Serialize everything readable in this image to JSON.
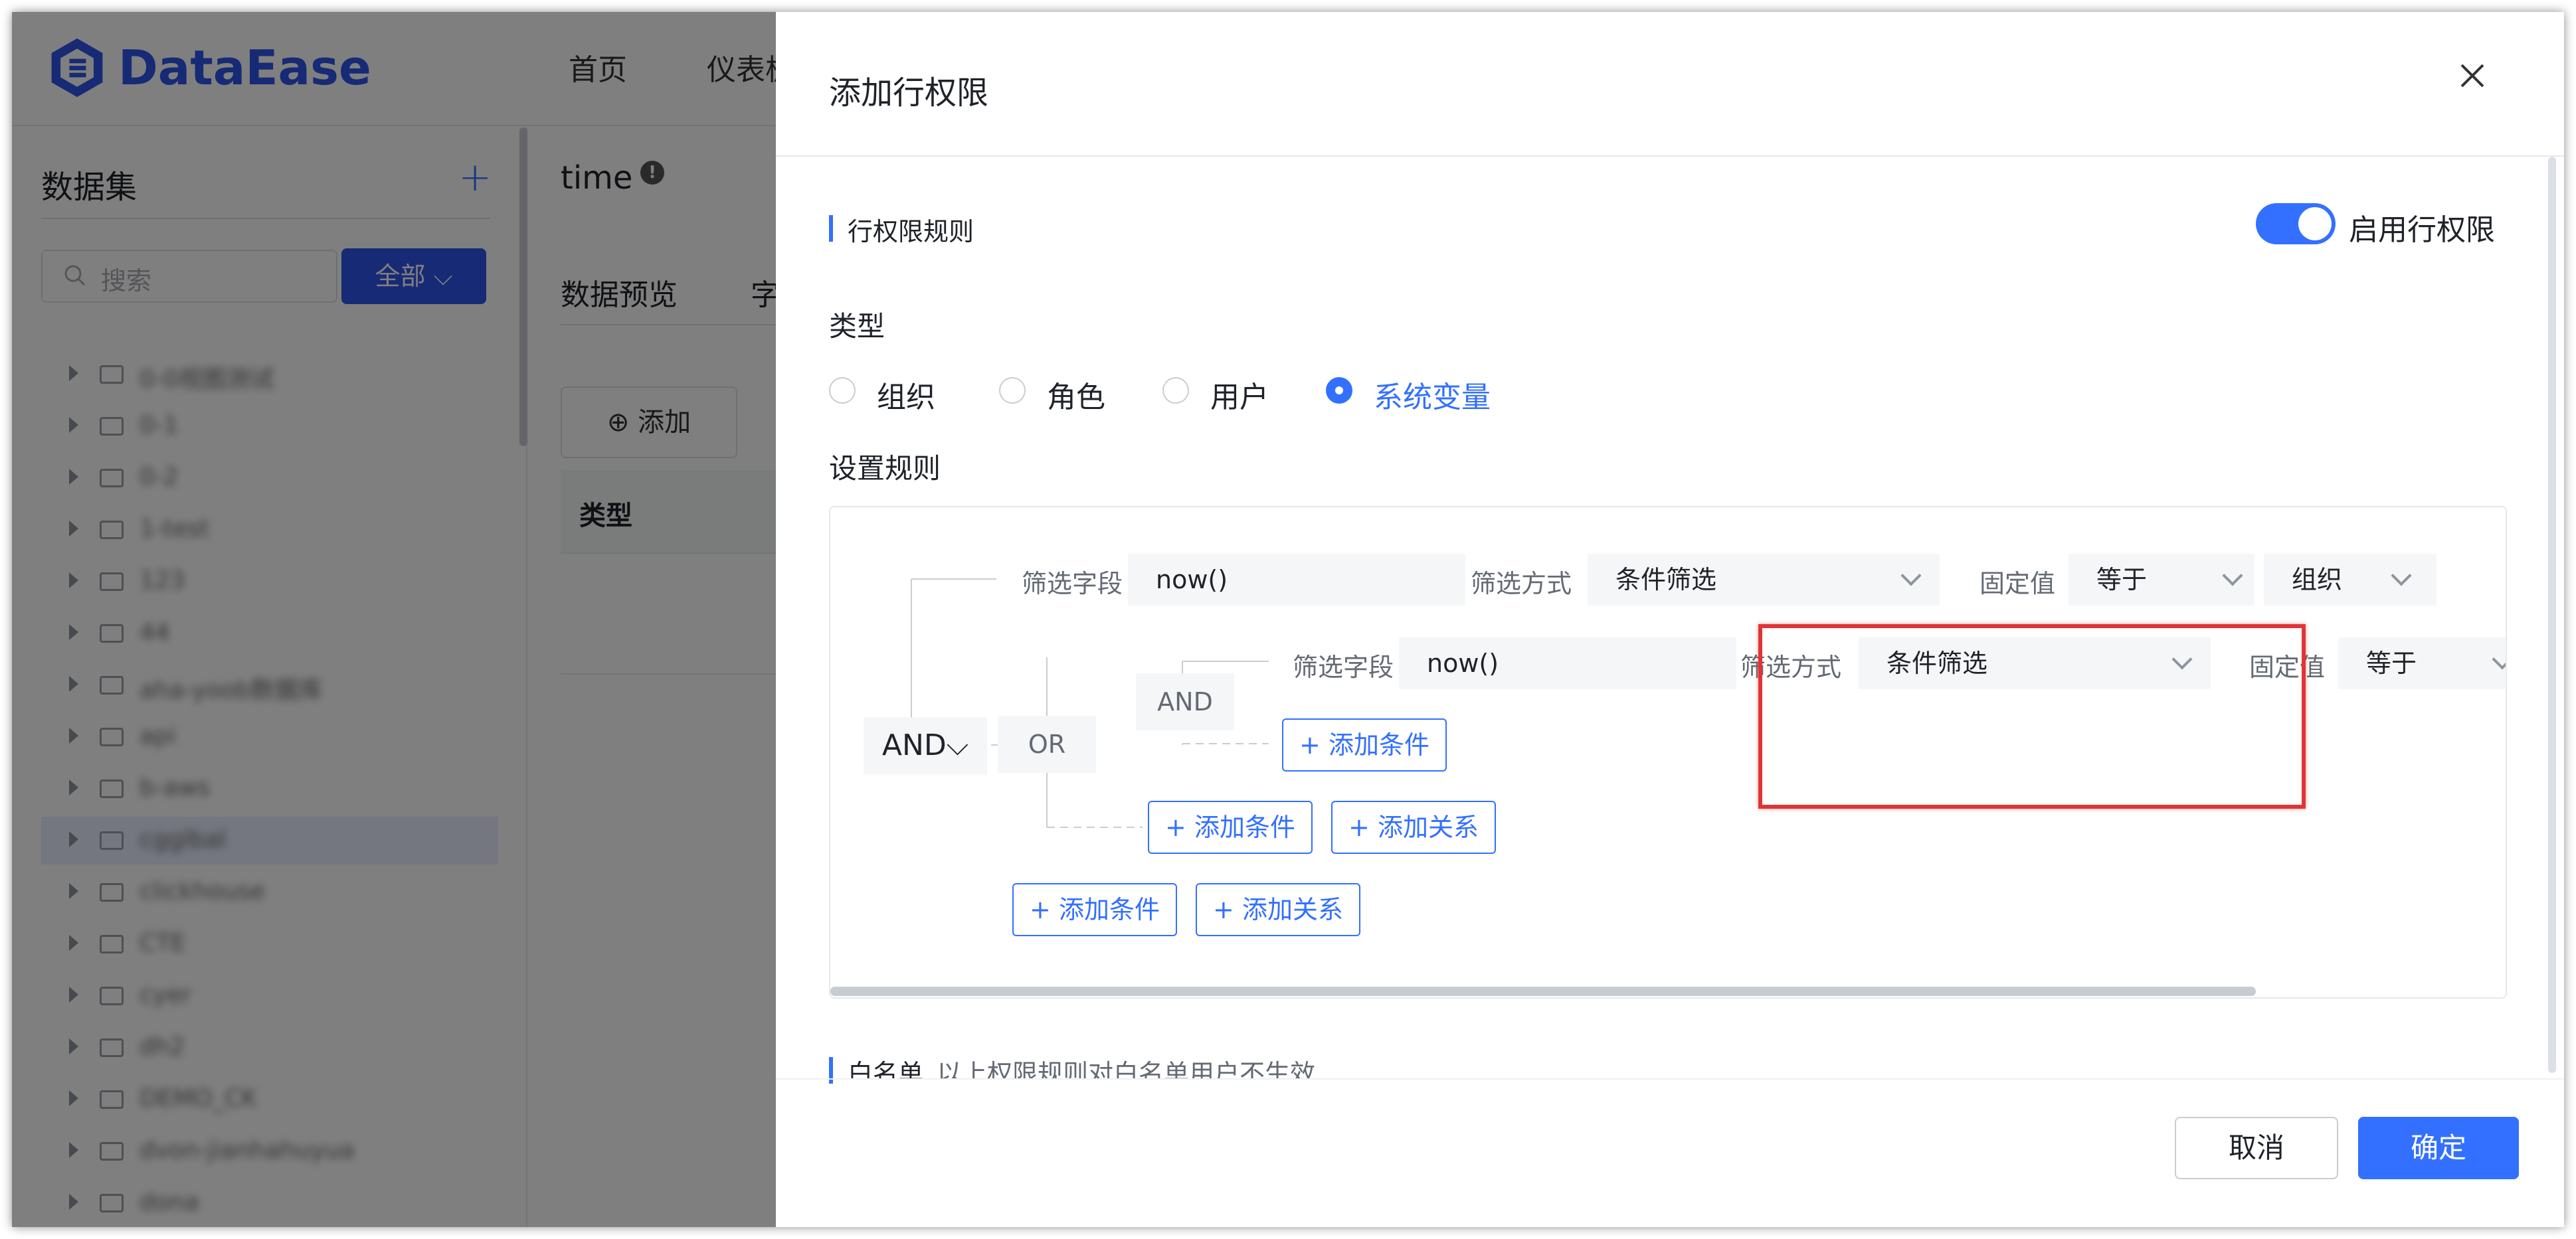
{
  "app": {
    "brand": "DataEase",
    "nav": [
      "首页",
      "仪表板"
    ]
  },
  "sidebar": {
    "title": "数据集",
    "add_icon": "plus-icon",
    "search_placeholder": "搜索",
    "filter_label": "全部",
    "tree": [
      "0-0视图测试",
      "0-1",
      "0-2",
      "1-test",
      "123",
      "44",
      "aha-yoob数据库",
      "api",
      "b-aws",
      "cgglbal",
      "clickhouse",
      "CTE",
      "cyer",
      "dh2",
      "DEMO_CK",
      "dvon-jianhahuyua",
      "dona"
    ]
  },
  "main": {
    "title": "time",
    "tabs": [
      "数据预览",
      "字"
    ],
    "add_button": "添加",
    "table_header": "类型"
  },
  "drawer": {
    "title": "添加行权限",
    "section_rule": "行权限规则",
    "enable_label": "启用行权限",
    "type_label": "类型",
    "types": [
      "组织",
      "角色",
      "用户",
      "系统变量"
    ],
    "rule_label": "设置规则",
    "rules": {
      "root_relation": "AND",
      "row1": {
        "field_label": "筛选字段",
        "field_value": "now()",
        "method_label": "筛选方式",
        "method_value": "条件筛选",
        "fixed_label": "固定值",
        "op_value": "等于",
        "value": "组织"
      },
      "or_relation": "OR",
      "and_relation": "AND",
      "row2": {
        "field_label": "筛选字段",
        "field_value": "now()",
        "method_label": "筛选方式",
        "method_value": "条件筛选",
        "fixed_label": "固定值",
        "op_value": "等于"
      },
      "add_condition": "+ 添加条件",
      "add_relation": "+ 添加关系"
    },
    "whitelist_title": "白名单",
    "whitelist_hint": "以上权限规则对白名单用户不生效",
    "cancel": "取消",
    "confirm": "确定"
  },
  "colors": {
    "accent": "#3370ff",
    "brand": "#2f54eb",
    "highlight": "#e03535"
  }
}
